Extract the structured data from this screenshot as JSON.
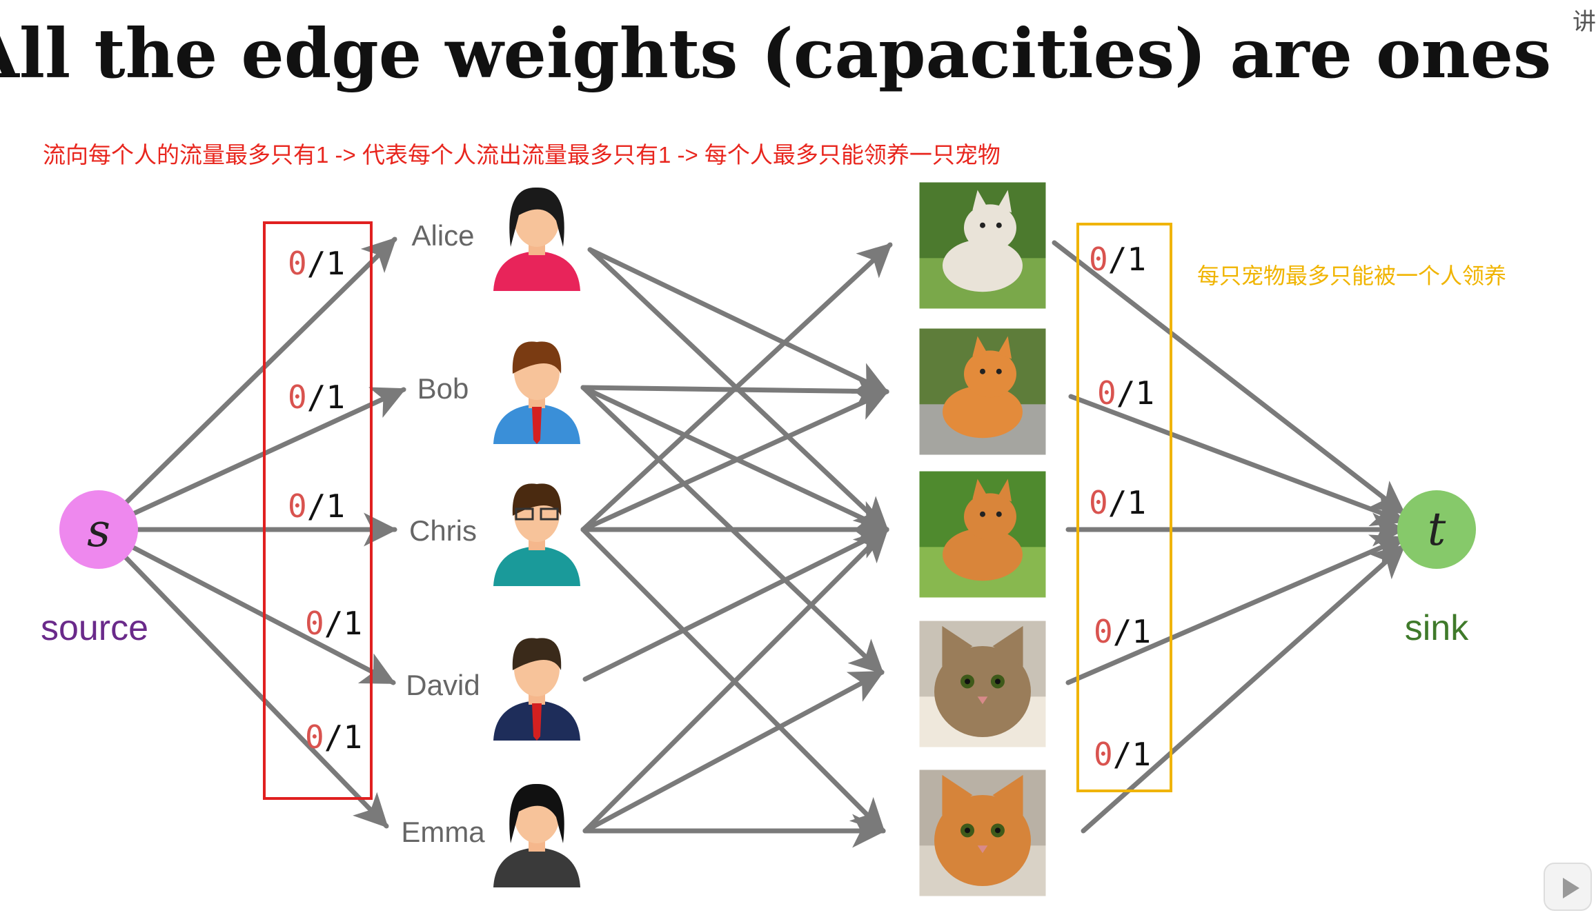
{
  "title": "All the edge weights (capacities) are ones",
  "annotation_red": "流向每个人的流量最多只有1 -> 代表每个人流出流量最多只有1 -> 每个人最多只能领养一只宠物",
  "annotation_orange": "每只宠物最多只能被一个人领养",
  "source": {
    "symbol": "s",
    "label": "source"
  },
  "sink": {
    "symbol": "t",
    "label": "sink"
  },
  "people": [
    {
      "name": "Alice",
      "icon": "woman-red-shirt-icon"
    },
    {
      "name": "Bob",
      "icon": "man-blue-suit-icon"
    },
    {
      "name": "Chris",
      "icon": "man-glasses-scarf-icon"
    },
    {
      "name": "David",
      "icon": "man-navy-suit-icon"
    },
    {
      "name": "Emma",
      "icon": "woman-dark-suit-icon"
    }
  ],
  "pets": [
    {
      "icon": "bulldog-photo-icon"
    },
    {
      "icon": "corgi-photo-icon"
    },
    {
      "icon": "shiba-photo-icon"
    },
    {
      "icon": "tabby-cat-photo-icon"
    },
    {
      "icon": "orange-cat-photo-icon"
    }
  ],
  "source_edge_labels": [
    {
      "flow": "0",
      "capacity": "1"
    },
    {
      "flow": "0",
      "capacity": "1"
    },
    {
      "flow": "0",
      "capacity": "1"
    },
    {
      "flow": "0",
      "capacity": "1"
    },
    {
      "flow": "0",
      "capacity": "1"
    }
  ],
  "sink_edge_labels": [
    {
      "flow": "0",
      "capacity": "1"
    },
    {
      "flow": "0",
      "capacity": "1"
    },
    {
      "flow": "0",
      "capacity": "1"
    },
    {
      "flow": "0",
      "capacity": "1"
    },
    {
      "flow": "0",
      "capacity": "1"
    }
  ],
  "person_pet_edges": [
    [
      0,
      1
    ],
    [
      0,
      2
    ],
    [
      1,
      1
    ],
    [
      1,
      2
    ],
    [
      1,
      3
    ],
    [
      2,
      0
    ],
    [
      2,
      1
    ],
    [
      2,
      2
    ],
    [
      2,
      4
    ],
    [
      3,
      2
    ],
    [
      4,
      2
    ],
    [
      4,
      3
    ],
    [
      4,
      4
    ]
  ],
  "colors": {
    "source_node": "#ee88ee",
    "source_label": "#6a2a8a",
    "sink_node": "#86c96a",
    "sink_label": "#3f7a2a",
    "edge": "#7a7a7a",
    "flow_digit": "#d9534f",
    "red_box": "#e02020",
    "orange_box": "#f0b400",
    "red_text": "#e8261e",
    "orange_text": "#f0b400",
    "person_name": "#666666"
  },
  "corner_glyph": "讲"
}
